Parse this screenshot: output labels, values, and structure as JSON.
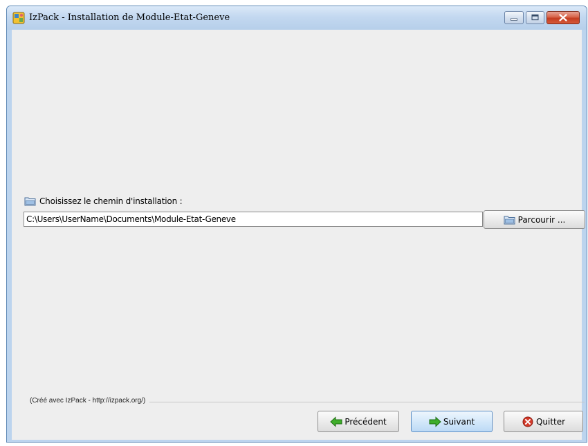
{
  "window": {
    "title": "IzPack - Installation de Module-Etat-Geneve"
  },
  "target_panel": {
    "label": "Choisissez le chemin d'installation :",
    "path_value": "C:\\Users\\UserName\\Documents\\Module-Etat-Geneve",
    "browse_label": "Parcourir ..."
  },
  "footer": {
    "credit": "(Créé avec IzPack - http://izpack.org/)"
  },
  "nav": {
    "previous_label": "Précédent",
    "next_label": "Suivant",
    "quit_label": "Quitter"
  },
  "icons": {
    "app": "izpack-app-icon",
    "label_folder": "folder-icon",
    "browse_folder": "folder-icon",
    "previous": "arrow-left-icon",
    "next": "arrow-right-icon",
    "quit": "close-circle-icon"
  },
  "colors": {
    "arrow_green": "#3fae2a",
    "quit_red": "#d33a2a",
    "title_close": "#c43d22"
  }
}
